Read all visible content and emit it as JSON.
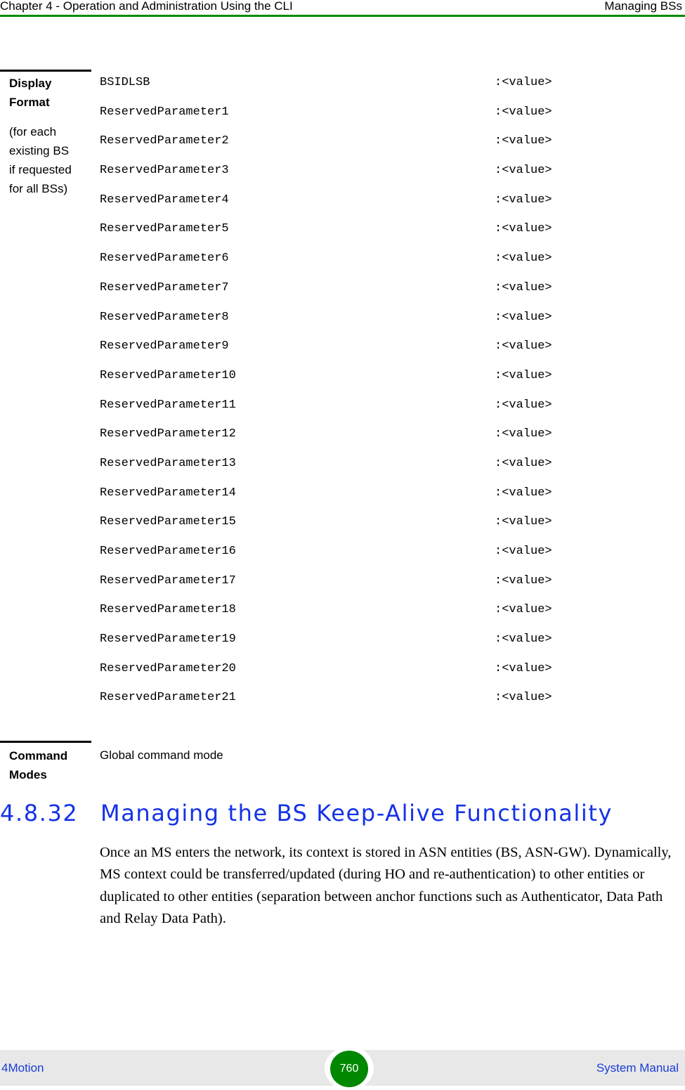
{
  "header": {
    "chapter": "Chapter 4 - Operation and Administration Using the CLI",
    "section": "Managing BSs",
    "accent_color": "#008a00"
  },
  "display_format": {
    "label": "Display Format",
    "label_line1": "Display",
    "label_line2": "Format",
    "note_lines": [
      "(for each",
      "existing BS",
      "if requested",
      "for all BSs)"
    ],
    "rows": [
      {
        "name": "BSIDLSB",
        "value": ":<value>"
      },
      {
        "name": "ReservedParameter1",
        "value": ":<value>"
      },
      {
        "name": "ReservedParameter2",
        "value": ":<value>"
      },
      {
        "name": "ReservedParameter3",
        "value": ":<value>"
      },
      {
        "name": "ReservedParameter4",
        "value": ":<value>"
      },
      {
        "name": "ReservedParameter5",
        "value": ":<value>"
      },
      {
        "name": "ReservedParameter6",
        "value": ":<value>"
      },
      {
        "name": "ReservedParameter7",
        "value": ":<value>"
      },
      {
        "name": "ReservedParameter8",
        "value": ":<value>"
      },
      {
        "name": "ReservedParameter9",
        "value": ":<value>"
      },
      {
        "name": "ReservedParameter10",
        "value": ":<value>"
      },
      {
        "name": "ReservedParameter11",
        "value": ":<value>"
      },
      {
        "name": "ReservedParameter12",
        "value": ":<value>"
      },
      {
        "name": "ReservedParameter13",
        "value": ":<value>"
      },
      {
        "name": "ReservedParameter14",
        "value": ":<value>"
      },
      {
        "name": "ReservedParameter15",
        "value": ":<value>"
      },
      {
        "name": "ReservedParameter16",
        "value": ":<value>"
      },
      {
        "name": "ReservedParameter17",
        "value": ":<value>"
      },
      {
        "name": "ReservedParameter18",
        "value": ":<value>"
      },
      {
        "name": "ReservedParameter19",
        "value": ":<value>"
      },
      {
        "name": "ReservedParameter20",
        "value": ":<value>"
      },
      {
        "name": "ReservedParameter21",
        "value": ":<value>"
      }
    ]
  },
  "command_modes": {
    "label_line1": "Command",
    "label_line2": "Modes",
    "value": "Global command mode"
  },
  "section": {
    "number": "4.8.32",
    "title": "Managing the BS Keep-Alive Functionality",
    "title_color": "#1432e6",
    "body": "Once an MS enters the network, its context is stored in ASN entities (BS, ASN-GW). Dynamically, MS context could be transferred/updated (during HO and re-authentication) to other entities or duplicated to other entities (separation between anchor functions such as Authenticator, Data Path and Relay Data Path)."
  },
  "footer": {
    "left": "4Motion",
    "page_number": "760",
    "right": "System Manual",
    "link_color": "#1a3cd9",
    "badge_color": "#008800"
  }
}
